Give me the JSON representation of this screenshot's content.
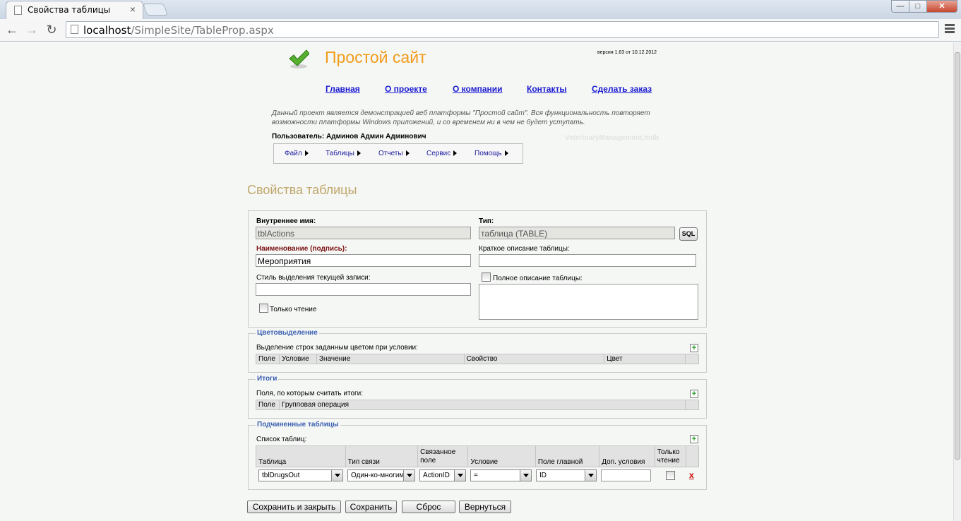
{
  "browser": {
    "tab_title": "Свойства таблицы",
    "tab_close": "×",
    "url_host": "localhost",
    "url_path": "/SimpleSite/TableProp.aspx",
    "win_min": "—",
    "win_max": "□",
    "win_close": "✕",
    "back": "←",
    "forward": "→",
    "reload": "↻"
  },
  "site": {
    "title": "Простой сайт",
    "version": "версия 1.63 от 10.12.2012",
    "nav": [
      "Главная",
      "О проекте",
      "О компании",
      "Контакты",
      "Сделать заказ"
    ],
    "description": "Данный проект является демонстрацией веб платформы \"Простой сайт\". Вся функциональность повторяет возможности платформы Windows приложений, и со временем ни в чем не будет уступать.",
    "user": "Пользователь: Админов Админ Админович",
    "db_name": "VeterinaryManagement.mdb",
    "menu": [
      "Файл",
      "Таблицы",
      "Отчеты",
      "Сервис",
      "Помощь"
    ]
  },
  "heading": "Свойства таблицы",
  "props": {
    "internal_name_label": "Внутреннее имя:",
    "internal_name_value": "tblActions",
    "type_label": "Тип:",
    "type_value": "таблица (TABLE)",
    "sql_button": "SQL",
    "caption_label": "Наименование (подпись):",
    "caption_value": "Мероприятия",
    "short_desc_label": "Краткое описание таблицы:",
    "short_desc_value": "",
    "style_label": "Стиль выделения текущей записи:",
    "style_value": "",
    "full_desc_label": "Полное описание таблицы:",
    "readonly_label": "Только чтение"
  },
  "color_section": {
    "legend": "Цветовыделение",
    "caption": "Выделение строк заданным цветом при условии:",
    "columns": [
      "Поле",
      "Условие",
      "Значение",
      "Свойство",
      "Цвет"
    ]
  },
  "totals_section": {
    "legend": "Итоги",
    "caption": "Поля, по которым считать итоги:",
    "columns": [
      "Поле",
      "Групповая операция"
    ]
  },
  "child_section": {
    "legend": "Подчиненные таблицы",
    "caption": "Список таблиц:",
    "columns": [
      "Таблица",
      "Тип связи",
      "Связанное поле",
      "Условие",
      "Поле главной",
      "Доп. условия",
      "Только чтение"
    ],
    "row": {
      "table": "tblDrugsOut",
      "link_type": "Один-ко-многим",
      "linked_field": "ActionID",
      "condition": "=",
      "master_field": "ID",
      "extra": "",
      "delete": "x"
    }
  },
  "plus": "+",
  "buttons": {
    "save_close": "Сохранить и закрыть",
    "save": "Сохранить",
    "reset": "Сброс",
    "back": "Вернуться"
  }
}
